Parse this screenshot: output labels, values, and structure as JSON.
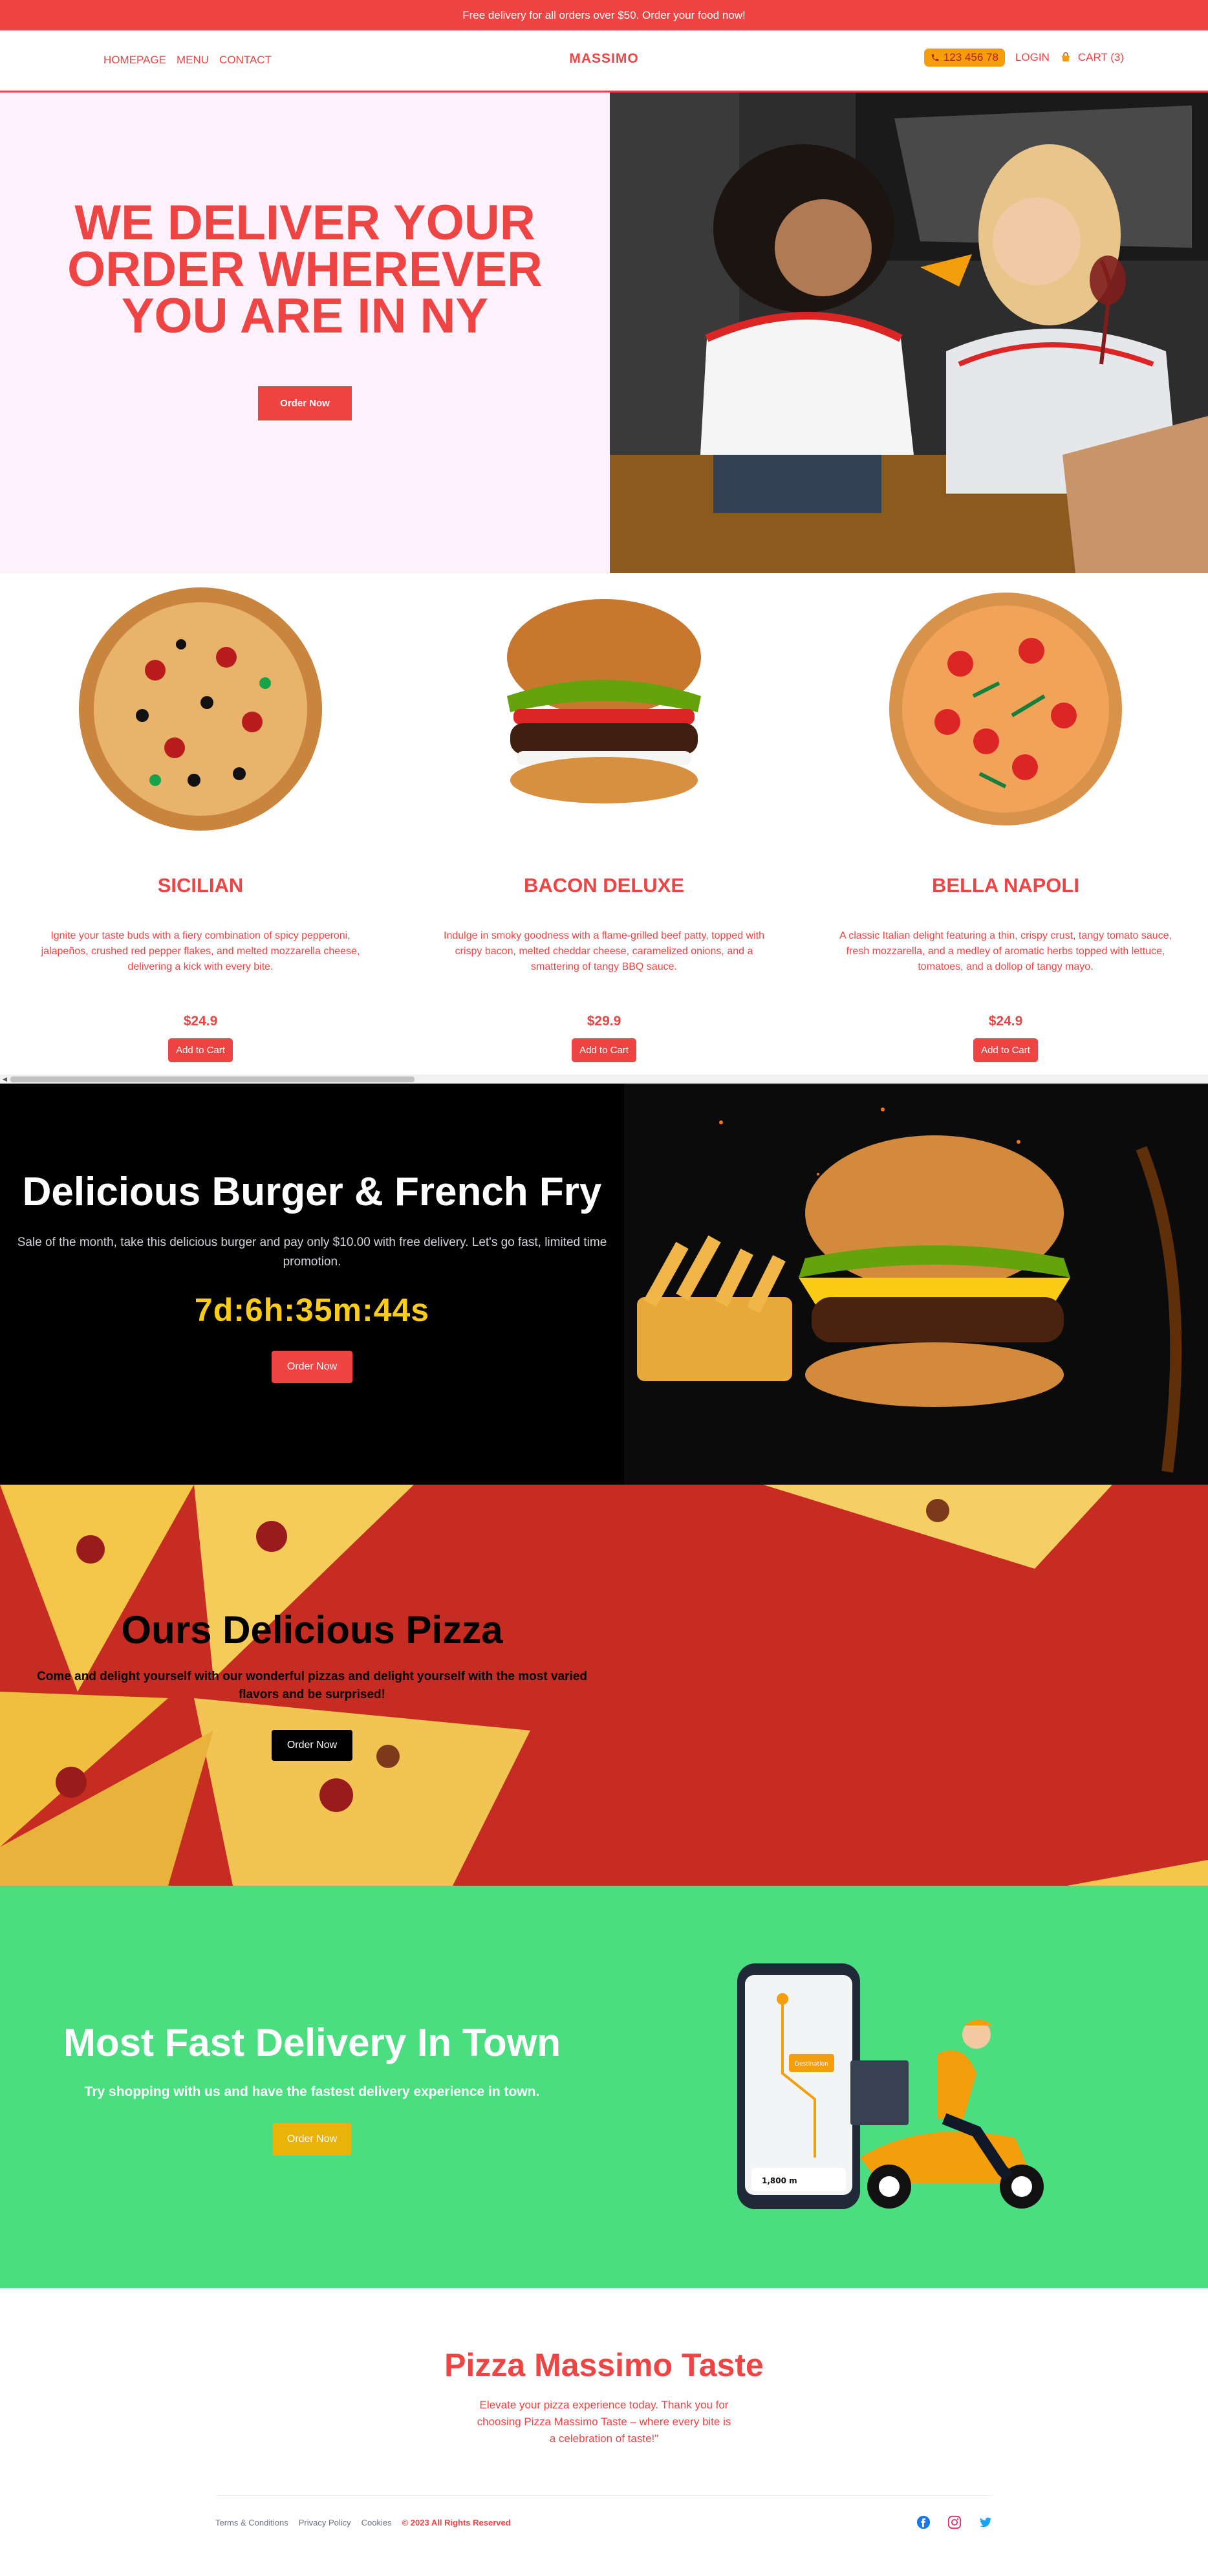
{
  "announcement": "Free delivery for all orders over $50. Order your food now!",
  "nav": {
    "links": [
      "HOMEPAGE",
      "MENU",
      "CONTACT"
    ],
    "brand": "MASSIMO",
    "phone": "123 456 78",
    "login": "LOGIN",
    "cart": "CART (3)"
  },
  "hero": {
    "title": "WE DELIVER YOUR ORDER WHEREVER YOU ARE IN NY",
    "cta": "Order Now"
  },
  "products": [
    {
      "name": "SICILIAN",
      "description": "Ignite your taste buds with a fiery combination of spicy pepperoni, jalapeños, crushed red pepper flakes, and melted mozzarella cheese, delivering a kick with every bite.",
      "price": "$24.9",
      "button": "Add to Cart"
    },
    {
      "name": "BACON DELUXE",
      "description": "Indulge in smoky goodness with a flame-grilled beef patty, topped with crispy bacon, melted cheddar cheese, caramelized onions, and a smattering of tangy BBQ sauce.",
      "price": "$29.9",
      "button": "Add to Cart"
    },
    {
      "name": "BELLA NAPOLI",
      "description": "A classic Italian delight featuring a thin, crispy crust, tangy tomato sauce, fresh mozzarella, and a medley of aromatic herbs topped with lettuce, tomatoes, and a dollop of tangy mayo.",
      "price": "$24.9",
      "button": "Add to Cart"
    }
  ],
  "promo": {
    "title": "Delicious Burger & French Fry",
    "text": "Sale of the month, take this delicious burger and pay only $10.00 with free delivery. Let's go fast, limited time promotion.",
    "countdown": "7d:6h:35m:44s",
    "cta": "Order Now"
  },
  "pizza_banner": {
    "title": "Ours Delicious Pizza",
    "text": "Come and delight yourself with our wonderful pizzas and delight yourself with the most varied flavors and be surprised!",
    "cta": "Order Now"
  },
  "delivery": {
    "title": "Most Fast Delivery In Town",
    "text": "Try shopping with us and have the fastest delivery experience in town.",
    "cta": "Order Now",
    "map_distance": "1,800 m",
    "map_label": "Destination"
  },
  "footer": {
    "title": "Pizza Massimo Taste",
    "text": "Elevate your pizza experience today. Thank you for choosing Pizza Massimo Taste – where every bite is a celebration of taste!\"",
    "links": [
      "Terms & Conditions",
      "Privacy Policy",
      "Cookies"
    ],
    "copyright": "© 2023 All Rights Reserved"
  },
  "icons": {
    "phone": "phone-icon",
    "cart": "cart-icon",
    "social": [
      "facebook-icon",
      "instagram-icon",
      "twitter-icon"
    ]
  },
  "colors": {
    "accent": "#ef4444",
    "hero_bg": "#fdf2fb",
    "promo_bg": "#000000",
    "countdown": "#facc15",
    "pizza_bg": "#c72c22",
    "delivery_bg": "#4ade80",
    "delivery_btn": "#eab308"
  }
}
